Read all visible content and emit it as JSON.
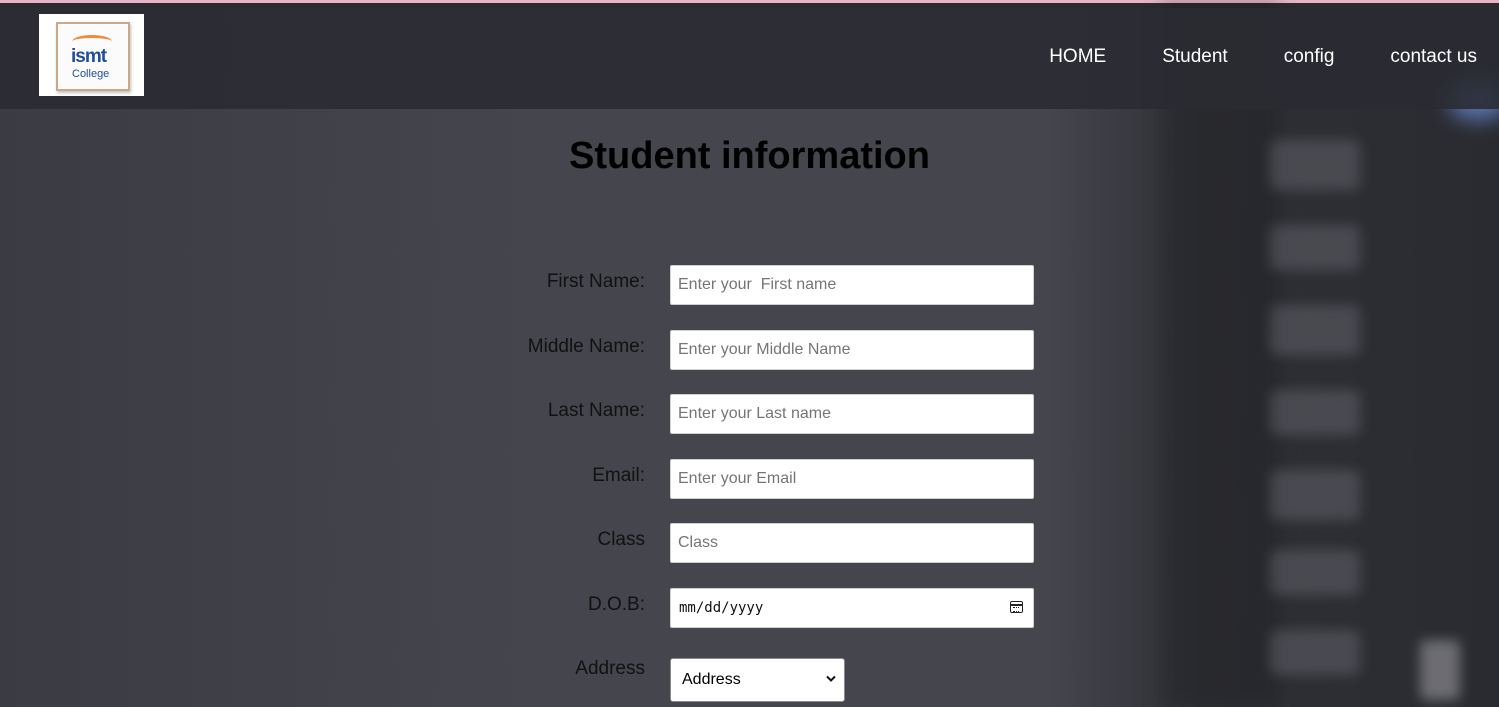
{
  "header": {
    "logo": {
      "brand": "ismt",
      "sub": "College"
    },
    "nav": [
      {
        "label": "HOME"
      },
      {
        "label": "Student"
      },
      {
        "label": "config"
      },
      {
        "label": "contact us"
      }
    ]
  },
  "page": {
    "title": "Student information"
  },
  "form": {
    "first_name": {
      "label": "First Name:",
      "placeholder": "Enter your  First name"
    },
    "middle_name": {
      "label": "Middle Name:",
      "placeholder": "Enter your Middle Name"
    },
    "last_name": {
      "label": "Last Name:",
      "placeholder": "Enter your Last name"
    },
    "email": {
      "label": "Email:",
      "placeholder": "Enter your Email"
    },
    "class": {
      "label": "Class",
      "placeholder": "Class"
    },
    "dob": {
      "label": "D.O.B:",
      "value": "mm/dd/yyyy",
      "icon": "calendar-icon"
    },
    "address": {
      "label": "Address",
      "selected": "Address",
      "icon": "chevron-down-icon"
    }
  },
  "colors": {
    "header_bg": "#2a2b32",
    "accent_strip": "#e8b3c8",
    "logo_blue": "#1f4e9c",
    "logo_orange": "#f08a3c"
  }
}
